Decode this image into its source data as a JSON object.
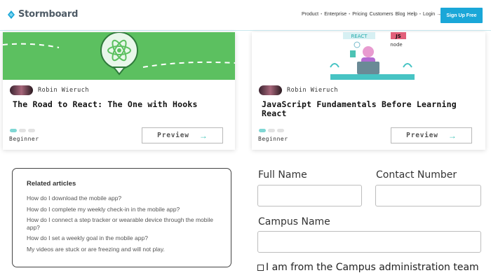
{
  "header": {
    "logo_text": "Stormboard",
    "nav": [
      "Product",
      "Enterprise",
      "Pricing",
      "Customers",
      "Blog",
      "Help",
      "Login →"
    ],
    "signup_label": "Sign Up Free"
  },
  "cards": [
    {
      "author": "Robin Wieruch",
      "title": "The Road to React: The One with Hooks",
      "level": "Beginner",
      "preview_label": "Preview",
      "progress_dots_active": 1,
      "progress_dots_total": 3
    },
    {
      "author": "Robin Wieruch",
      "title": "JavaScript Fundamentals Before Learning React",
      "level": "Beginner",
      "preview_label": "Preview",
      "progress_dots_active": 1,
      "progress_dots_total": 3,
      "image_tags": [
        "REACT",
        "JS",
        "node"
      ]
    }
  ],
  "related": {
    "title": "Related articles",
    "items": [
      "How do I download the mobile app?",
      "How do I complete my weekly check-in in the mobile app?",
      "How do I connect a step tracker or wearable device through the mobile app?",
      "How do I set a weekly goal in the mobile app?",
      "My videos are stuck or are freezing and will not play."
    ]
  },
  "form": {
    "full_name_label": "Full Name",
    "contact_number_label": "Contact Number",
    "campus_name_label": "Campus Name",
    "full_name_value": "",
    "contact_number_value": "",
    "campus_name_value": "",
    "admin_checkbox_label": "I am from the Campus administration team",
    "admin_checked": false
  },
  "colors": {
    "accent": "#1aa7d8",
    "card_1_image_bg": "#5cc060",
    "progress_active": "#7fd7d4",
    "preview_arrow": "#3cc3b7"
  }
}
